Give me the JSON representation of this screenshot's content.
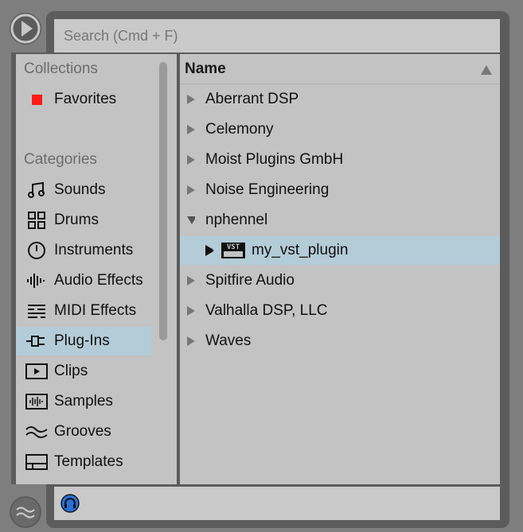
{
  "search": {
    "placeholder": "Search (Cmd + F)"
  },
  "sidebar": {
    "collections_header": "Collections",
    "collections": [
      {
        "label": "Favorites",
        "color": "#ff1a1a",
        "icon": "red-square-icon"
      }
    ],
    "categories_header": "Categories",
    "categories": [
      {
        "label": "Sounds",
        "icon": "music-note-icon"
      },
      {
        "label": "Drums",
        "icon": "drum-grid-icon"
      },
      {
        "label": "Instruments",
        "icon": "instrument-knob-icon"
      },
      {
        "label": "Audio Effects",
        "icon": "waveform-icon"
      },
      {
        "label": "MIDI Effects",
        "icon": "midi-effects-icon"
      },
      {
        "label": "Plug-Ins",
        "icon": "plug-icon",
        "selected": true
      },
      {
        "label": "Clips",
        "icon": "clip-play-icon"
      },
      {
        "label": "Samples",
        "icon": "sample-wave-icon"
      },
      {
        "label": "Grooves",
        "icon": "groove-wave-icon"
      },
      {
        "label": "Templates",
        "icon": "template-icon"
      }
    ]
  },
  "browser": {
    "column_header": "Name",
    "sort": "ascending",
    "items": [
      {
        "label": "Aberrant DSP",
        "expanded": false
      },
      {
        "label": "Celemony",
        "expanded": false
      },
      {
        "label": "Moist Plugins GmbH",
        "expanded": false
      },
      {
        "label": "Noise Engineering",
        "expanded": false
      },
      {
        "label": "nphennel",
        "expanded": true
      },
      {
        "label": "my_vst_plugin",
        "child": true,
        "selected": true,
        "icon_text": "VST"
      },
      {
        "label": "Spitfire Audio",
        "expanded": false
      },
      {
        "label": "Valhalla DSP, LLC",
        "expanded": false
      },
      {
        "label": "Waves",
        "expanded": false
      }
    ]
  },
  "colors": {
    "selection": "#b4ccd8",
    "panel": "#c3c3c3",
    "frame": "#5c5c5c",
    "favorite": "#ff1a1a",
    "hotswap_accent": "#2a6fd6"
  }
}
